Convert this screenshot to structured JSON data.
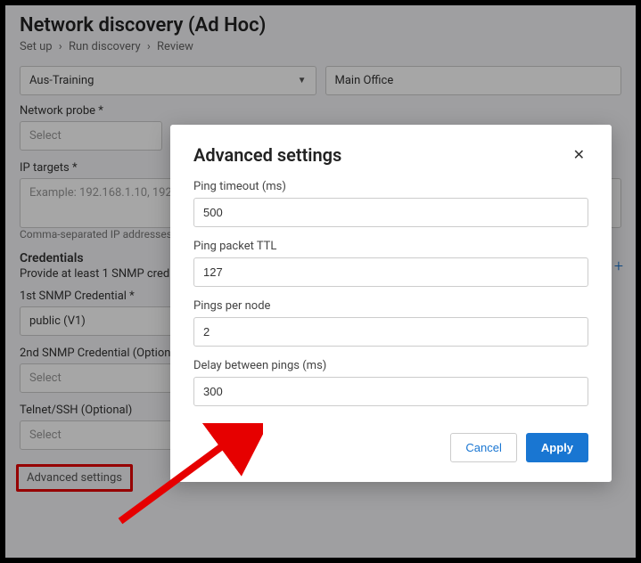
{
  "header": {
    "title": "Network discovery (Ad Hoc)",
    "breadcrumb": [
      "Set up",
      "Run discovery",
      "Review"
    ]
  },
  "form": {
    "top_left_select": "Aus-Training",
    "top_right_select": "Main Office",
    "network_probe_label": "Network probe *",
    "network_probe_value": "Select",
    "ip_targets_label": "IP targets *",
    "ip_targets_placeholder": "Example: 192.168.1.10, 192.1",
    "ip_targets_hint": "Comma-separated IP addresses, I",
    "credentials_section": "Credentials",
    "credentials_hint": "Provide at least 1 SNMP cred",
    "snmp1_label": "1st SNMP Credential *",
    "snmp1_value": "public (V1)",
    "snmp2_label": "2nd SNMP Credential (Option",
    "snmp2_value": "Select",
    "telnet_label": "Telnet/SSH (Optional)",
    "telnet_value": "Select",
    "advanced_link": "Advanced settings"
  },
  "modal": {
    "title": "Advanced settings",
    "fields": {
      "ping_timeout_label": "Ping timeout (ms)",
      "ping_timeout_value": "500",
      "ping_ttl_label": "Ping packet TTL",
      "ping_ttl_value": "127",
      "pings_per_node_label": "Pings per node",
      "pings_per_node_value": "2",
      "delay_label": "Delay between pings (ms)",
      "delay_value": "300"
    },
    "cancel_label": "Cancel",
    "apply_label": "Apply"
  }
}
